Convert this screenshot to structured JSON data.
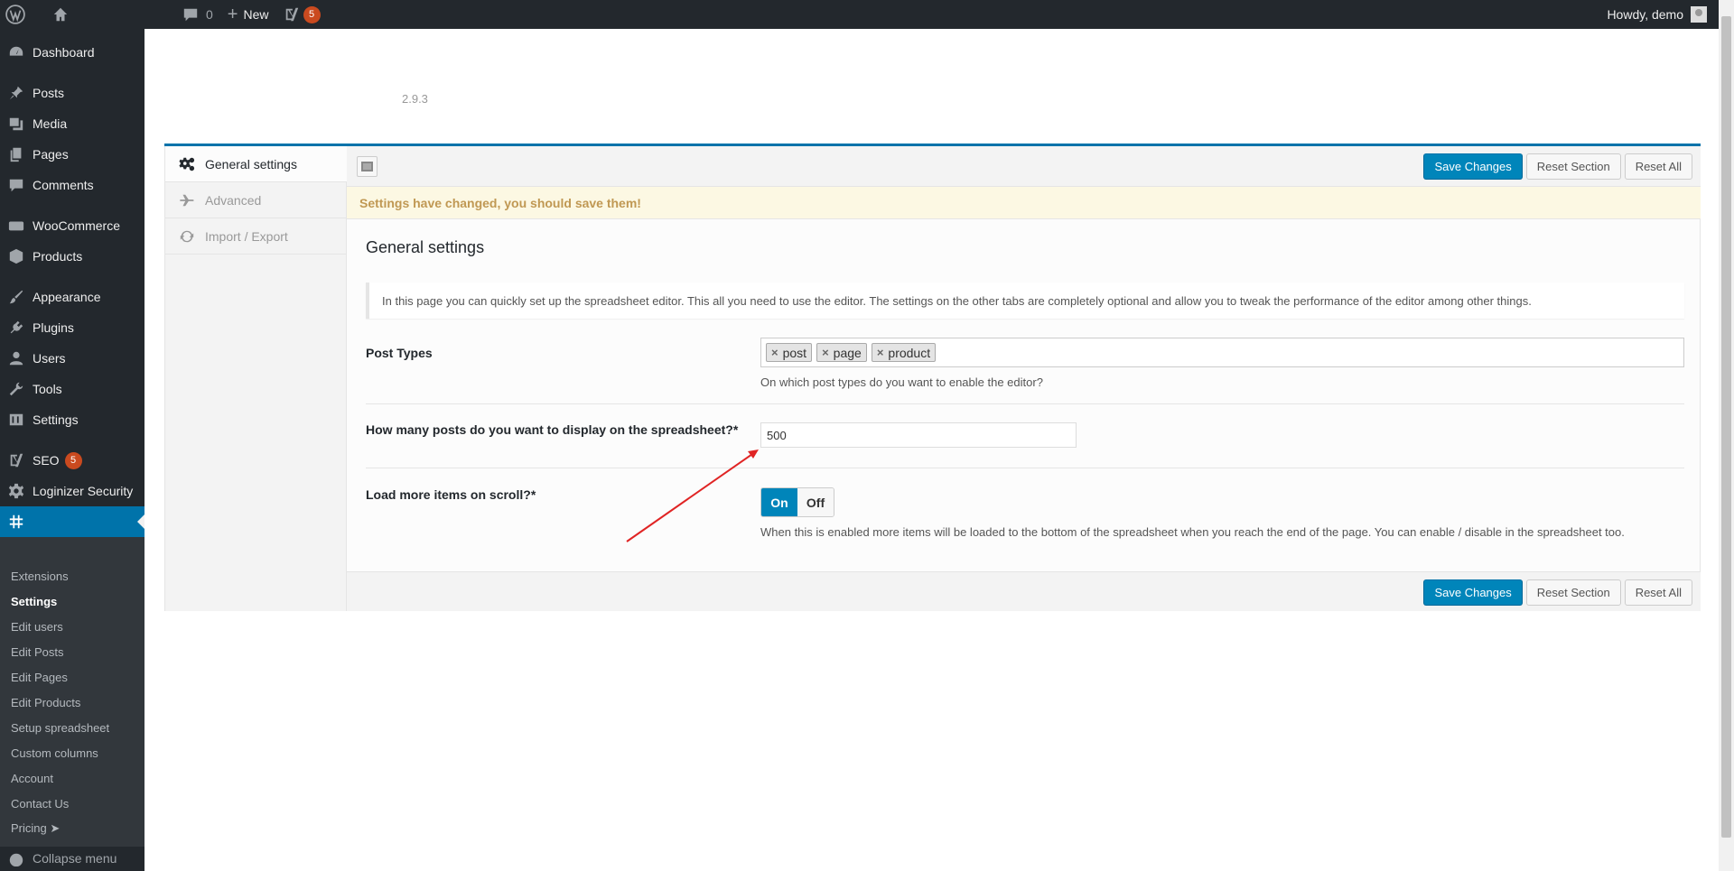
{
  "adminbar": {
    "comments_count": "0",
    "new_label": "New",
    "seo_count": "5",
    "howdy": "Howdy, demo"
  },
  "menu": {
    "dashboard": "Dashboard",
    "posts": "Posts",
    "media": "Media",
    "pages": "Pages",
    "comments": "Comments",
    "woocommerce": "WooCommerce",
    "products": "Products",
    "appearance": "Appearance",
    "plugins": "Plugins",
    "users": "Users",
    "tools": "Tools",
    "settings": "Settings",
    "seo": "SEO",
    "seo_count": "5",
    "loginizer": "Loginizer Security",
    "collapse": "Collapse menu"
  },
  "submenu": [
    "Extensions",
    "Settings",
    "Edit users",
    "Edit Posts",
    "Edit Pages",
    "Edit Products",
    "Setup spreadsheet",
    "Custom columns",
    "Account",
    "Contact Us",
    "Pricing ➤"
  ],
  "header": {
    "version": "2.9.3"
  },
  "tabs": {
    "general": "General settings",
    "advanced": "Advanced",
    "import_export": "Import / Export"
  },
  "buttons": {
    "save": "Save Changes",
    "reset_section": "Reset Section",
    "reset_all": "Reset All"
  },
  "notice": "Settings have changed, you should save them!",
  "section": {
    "title": "General settings",
    "description": "In this page you can quickly set up the spreadsheet editor. This all you need to use the editor. The settings on the other tabs are completely optional and allow you to tweak the performance of the editor among other things."
  },
  "fields": {
    "post_types": {
      "label": "Post Types",
      "tags": [
        "post",
        "page",
        "product"
      ],
      "hint": "On which post types do you want to enable the editor?"
    },
    "posts_count": {
      "label": "How many posts do you want to display on the spreadsheet?*",
      "value": "500"
    },
    "load_more": {
      "label": "Load more items on scroll?*",
      "on": "On",
      "off": "Off",
      "hint": "When this is enabled more items will be loaded to the bottom of the spreadsheet when you reach the end of the page. You can enable / disable in the spreadsheet too."
    }
  },
  "colors": {
    "admin_dark": "#23282d",
    "accent": "#0073aa",
    "primary_button": "#0085ba",
    "notice_bg": "#fcf8e3",
    "notice_text": "#c09853",
    "arrow": "#e02424"
  }
}
